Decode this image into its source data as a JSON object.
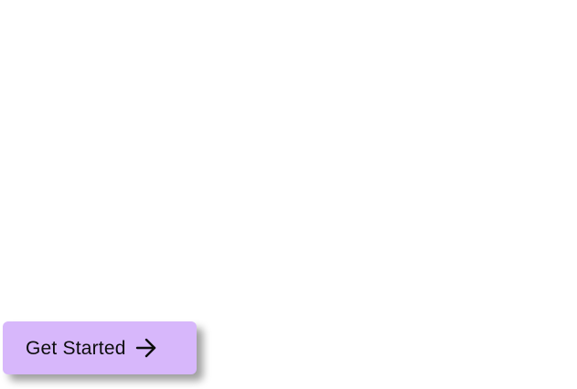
{
  "cta": {
    "label": "Get Started",
    "icon": "arrow-right-icon",
    "background_color": "#d7b7fb",
    "text_color": "#0d0d0d"
  },
  "page": {
    "background_color": "#ffffff"
  }
}
